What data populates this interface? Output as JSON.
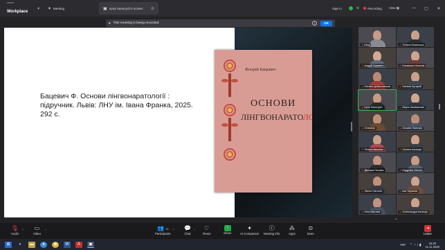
{
  "titlebar": {
    "brand_small": "zoom",
    "brand_main": "Workplace",
    "meeting_tab": "Meeting",
    "share_tab": "Iryna Savenych's screen",
    "sign_in": "Sign in",
    "recording_label": "Recording",
    "view_label": "View"
  },
  "banner": {
    "text": "This meeting is being recorded.",
    "ok_label": "OK"
  },
  "slide": {
    "citation": "Бацевич Ф. Основи лінгвонаратології : підручник. Львів: ЛНУ ім. Івана Франка, 2025. 292 с."
  },
  "book": {
    "author": "Флорій Бацевич",
    "title_line1": "ОСНОВИ",
    "title_line2_a": "ЛІНГВОНАРАТО",
    "title_line2_b": "ЛОГІЇ"
  },
  "gallery": {
    "participants": [
      {
        "name": "Юля",
        "skin": "#c79a85",
        "shirt": "#8a8a90"
      },
      {
        "name": "Тетяна Білинська",
        "skin": "#c9a08c",
        "shirt": "#2e2e33"
      },
      {
        "name": "Андрій Бацевич",
        "skin": "#d2a994",
        "shirt": "#5b6a78"
      },
      {
        "name": "Космемко Наталія",
        "skin": "#cfa48f",
        "shirt": "#6b3d3a"
      },
      {
        "name": "Оксана Добушовська",
        "skin": "#b98a72",
        "shirt": "#a33c36"
      },
      {
        "name": "Наталя Бучарій",
        "skin": "#caa08a",
        "shirt": "#3f4552"
      },
      {
        "name": "Iryna Savenych",
        "skin": "#c99a80",
        "shirt": "#2a2a2a",
        "active": true
      },
      {
        "name": "Мирія Заліванова",
        "skin": "#d0a78f",
        "shirt": "#2c3440"
      },
      {
        "name": "Chabanp",
        "skin": "#c09078",
        "shirt": "#6a4a32"
      },
      {
        "name": "Оксана Пальчук",
        "skin": "#ba8d78",
        "shirt": "#4a5566"
      },
      {
        "name": "Тетяна Вишина",
        "skin": "#c8a088",
        "shirt": "#b04a55"
      },
      {
        "name": "Оксана Кучерук",
        "skin": "#cfa28c",
        "shirt": "#3a3d46"
      },
      {
        "name": "Дмицюк Оксана",
        "skin": "#c29580",
        "shirt": "#2a2a30"
      },
      {
        "name": "Мудрова Уліссія",
        "skin": "#c69c86",
        "shirt": "#55606e"
      },
      {
        "name": "Лахно Наталія",
        "skin": "#bf917c",
        "shirt": "#373a44"
      },
      {
        "name": "Іма Тарасюк",
        "skin": "#cba390",
        "shirt": "#6d4c3d"
      },
      {
        "name": "Ніна Маслюк",
        "skin": "#c19380",
        "shirt": "#485060"
      },
      {
        "name": "Олександра Кальчук",
        "skin": "#caa28d",
        "shirt": "#3c3c44"
      }
    ]
  },
  "toolbar": {
    "audio": "Audio",
    "video": "Video",
    "participants": "Participants",
    "participant_count": "19",
    "chat": "Chat",
    "react": "React",
    "share": "Share",
    "ai_companion": "AI Companion",
    "meeting_info": "Meeting info",
    "apps": "Apps",
    "more": "More",
    "leave": "Leave"
  },
  "taskbar": {
    "lang": "УКР",
    "time": "15:30",
    "date": "11.11.2025"
  },
  "colors": {
    "accent_blue": "#0e72ed",
    "share_green": "#23a845",
    "leave_red": "#d43030",
    "book_cover": "#d89c94"
  }
}
